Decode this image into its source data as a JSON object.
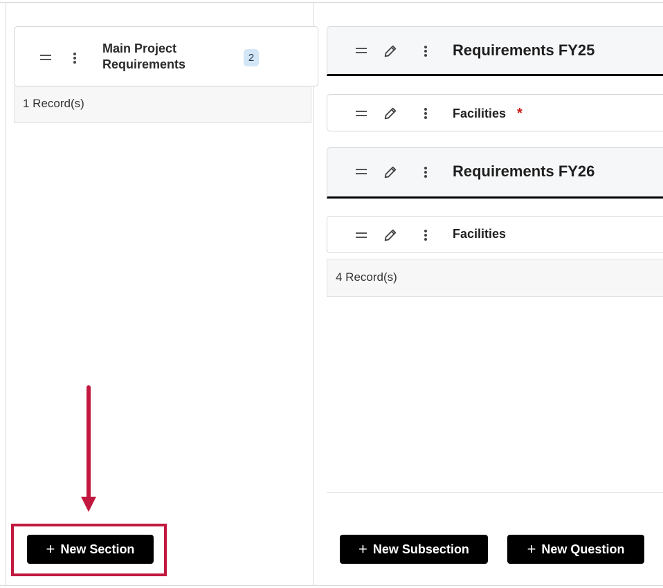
{
  "sections_panel": {
    "section": {
      "title": "Main Project Requirements",
      "count": "2"
    },
    "records_label": "1 Record(s)",
    "new_section_label": "New Section"
  },
  "content_panel": {
    "rows": [
      {
        "type": "subsection",
        "title": "Requirements FY25",
        "required": false
      },
      {
        "type": "question",
        "title": "Facilities",
        "required": true
      },
      {
        "type": "subsection",
        "title": "Requirements FY26",
        "required": false
      },
      {
        "type": "question",
        "title": "Facilities",
        "required": false
      }
    ],
    "required_marker": "*",
    "records_label": "4 Record(s)",
    "new_subsection_label": "New Subsection",
    "new_question_label": "New Question"
  },
  "icons": {
    "drag": "drag-handle-icon",
    "menu": "kebab-menu-icon",
    "edit": "pencil-icon",
    "add": "plus-icon"
  },
  "colors": {
    "annotation": "#c2183f",
    "badge_bg": "#d3e6f6",
    "button_bg": "#000000",
    "required": "#d11a1a"
  }
}
